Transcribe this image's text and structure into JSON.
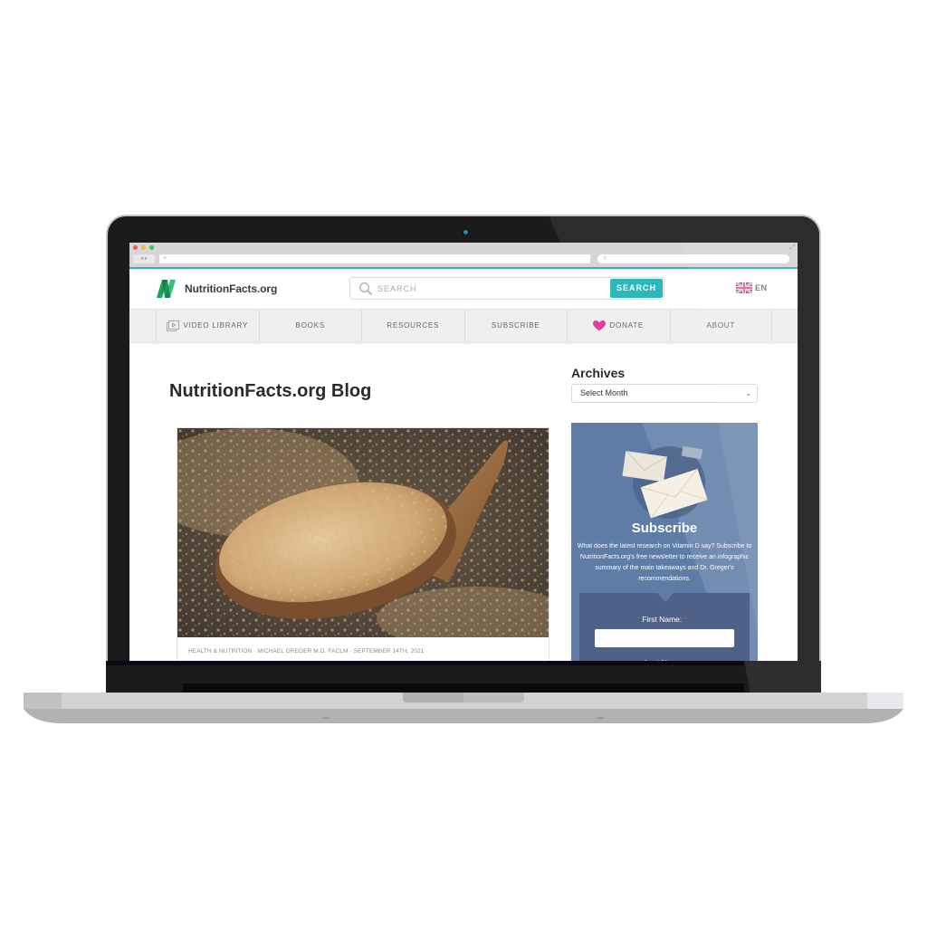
{
  "browser": {
    "url_placeholder": "+",
    "search_placeholder": "",
    "nav_arrows": "◂ ▸"
  },
  "header": {
    "logo_text": "NutritionFacts.org",
    "search_placeholder": "SEARCH",
    "search_button": "SEARCH",
    "language": "EN"
  },
  "nav": {
    "items": [
      {
        "label": "VIDEO LIBRARY",
        "icon": "video-library-icon"
      },
      {
        "label": "BOOKS"
      },
      {
        "label": "RESOURCES"
      },
      {
        "label": "SUBSCRIBE"
      },
      {
        "label": "DONATE",
        "icon": "heart-icon"
      },
      {
        "label": "ABOUT"
      }
    ]
  },
  "main": {
    "blog_title": "NutritionFacts.org Blog",
    "post": {
      "image_alt": "Nutritional yeast flakes on a wooden spoon",
      "meta": "HEALTH & NUTRITION · MICHAEL GREGER M.D. FACLM · SEPTEMBER 14TH, 2021"
    }
  },
  "sidebar": {
    "archives_title": "Archives",
    "archives_select": "Select Month",
    "subscribe": {
      "title": "Subscribe",
      "text": "What does the latest research on Vitamin D say? Subscribe to NutritionFacts.org's free newsletter to receive an infographic summary of the main takeaways and Dr. Greger's recommendations.",
      "first_name_label": "First Name:",
      "required_mark": "*",
      "last_name_label": "Last Name:"
    }
  },
  "colors": {
    "accent_teal": "#2cb8b8",
    "logo_green": "#1fae5b",
    "donate_heart": "#e0409a",
    "subscribe_bg": "#5d7ca6"
  }
}
